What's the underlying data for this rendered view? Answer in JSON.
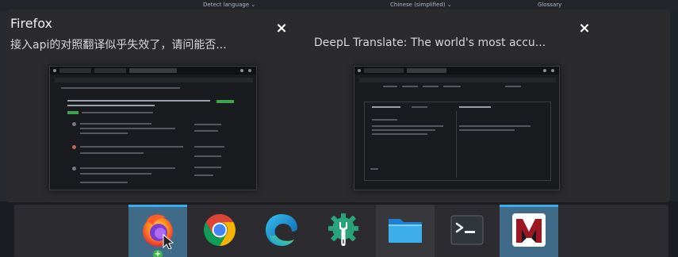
{
  "background": {
    "detect_language": "Detect language ⌄",
    "target_language": "Chinese (simplified) ⌄",
    "glossary": "Glossary"
  },
  "windows": [
    {
      "title": "Firefox",
      "subtitle": "接入api的对照翻译似乎失效了，请问能否...",
      "close_glyph": "×"
    },
    {
      "title": "",
      "subtitle": "DeepL Translate: The world's most accu...",
      "close_glyph": "×"
    }
  ],
  "taskbar": {
    "apps": [
      {
        "name": "Firefox",
        "icon": "firefox-icon",
        "active": true
      },
      {
        "name": "Google Chrome",
        "icon": "chrome-icon",
        "active": false
      },
      {
        "name": "Microsoft Edge",
        "icon": "edge-icon",
        "active": false
      },
      {
        "name": "System Settings",
        "icon": "settings-wrench-icon",
        "active": false
      },
      {
        "name": "Files",
        "icon": "folder-icon",
        "active": false
      },
      {
        "name": "Terminal",
        "icon": "terminal-icon",
        "active": false
      },
      {
        "name": "Mendeley",
        "icon": "mendeley-icon",
        "active": true
      }
    ],
    "add_badge": "+"
  },
  "colors": {
    "accent": "#3daee9",
    "active_slot": "#3f6a88",
    "panel": "#2b2b2e"
  }
}
